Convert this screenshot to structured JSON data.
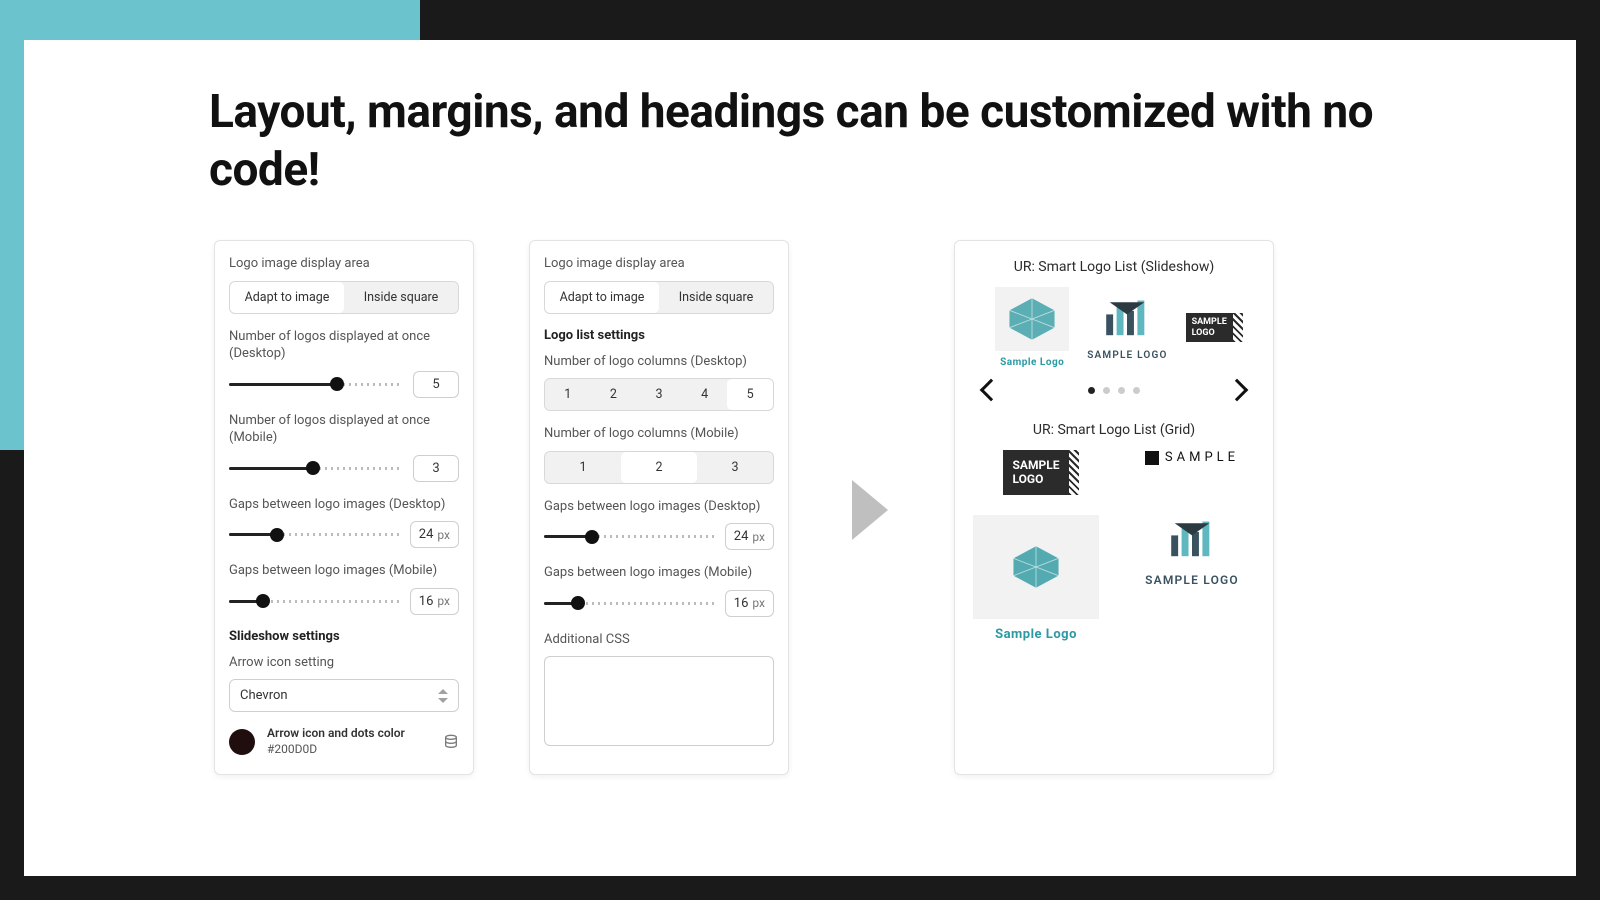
{
  "headline": "Layout, margins, and headings can be customized with no code!",
  "panel1": {
    "display_area_label": "Logo image display area",
    "seg": {
      "opt1": "Adapt to image",
      "opt2": "Inside square",
      "active": 0
    },
    "desktop_count_label": "Number of logos displayed at once (Desktop)",
    "desktop_count_value": "5",
    "desktop_count_pct": 62,
    "mobile_count_label": "Number of logos displayed at once (Mobile)",
    "mobile_count_value": "3",
    "mobile_count_pct": 48,
    "gap_desktop_label": "Gaps between logo images (Desktop)",
    "gap_desktop_value": "24",
    "gap_desktop_pct": 28,
    "gap_mobile_label": "Gaps between logo images (Mobile)",
    "gap_mobile_value": "16",
    "gap_mobile_pct": 20,
    "slideshow_head": "Slideshow settings",
    "arrow_label": "Arrow icon setting",
    "arrow_value": "Chevron",
    "color_label": "Arrow icon and dots color",
    "color_hex": "#200D0D"
  },
  "panel2": {
    "display_area_label": "Logo image display area",
    "seg": {
      "opt1": "Adapt to image",
      "opt2": "Inside square",
      "active": 0
    },
    "list_head": "Logo list settings",
    "desktop_cols_label": "Number of logo columns (Desktop)",
    "desktop_cols_opts": [
      "1",
      "2",
      "3",
      "4",
      "5"
    ],
    "desktop_cols_active": 4,
    "mobile_cols_label": "Number of logo columns (Mobile)",
    "mobile_cols_opts": [
      "1",
      "2",
      "3"
    ],
    "mobile_cols_active": 1,
    "gap_desktop_label": "Gaps between logo images (Desktop)",
    "gap_desktop_value": "24",
    "gap_desktop_pct": 28,
    "gap_mobile_label": "Gaps between logo images (Mobile)",
    "gap_mobile_value": "16",
    "gap_mobile_pct": 20,
    "css_label": "Additional CSS"
  },
  "preview": {
    "slideshow_title": "UR: Smart Logo List (Slideshow)",
    "grid_title": "UR: Smart Logo List (Grid)",
    "cap_hex": "Sample Logo",
    "cap_bars": "SAMPLE LOGO",
    "badge_line1": "SAMPLE",
    "badge_line2": "LOGO",
    "sample_wide": "SAMPLE"
  },
  "px": "px"
}
